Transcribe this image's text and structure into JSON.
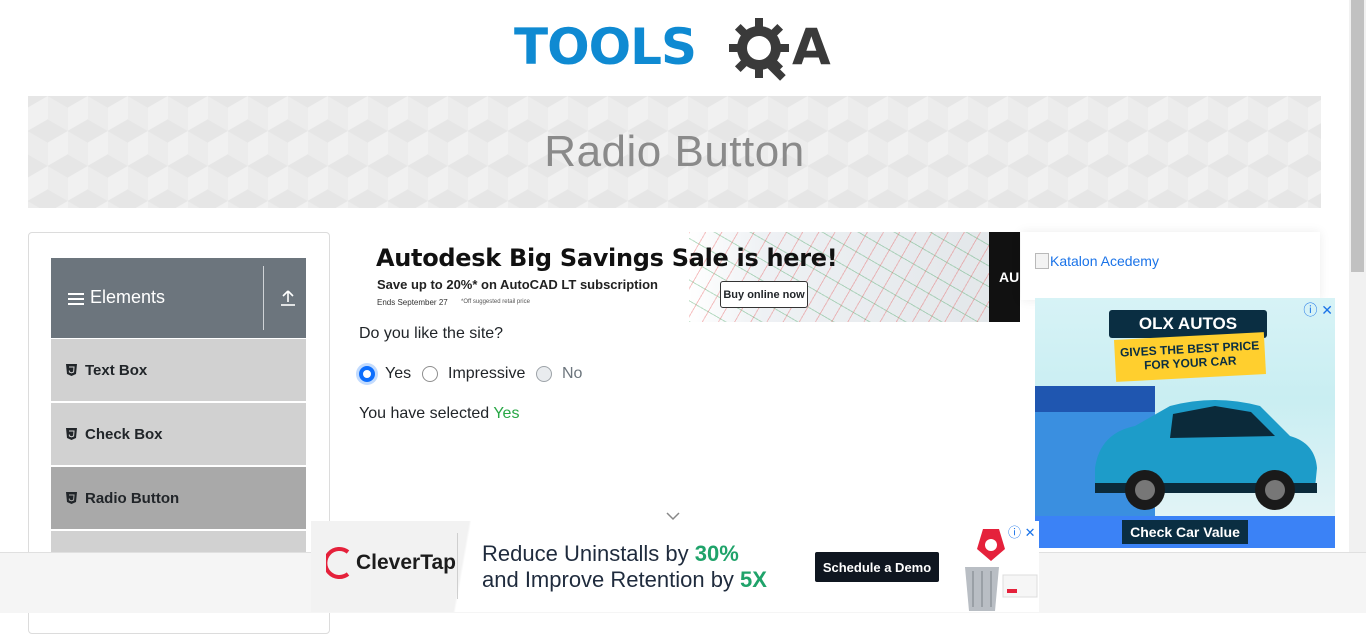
{
  "logo": {
    "text": "TOOLSQA",
    "part1": "TOOLS",
    "part2": "A"
  },
  "banner": {
    "title": "Radio Button"
  },
  "sidebar": {
    "group_title": "Elements",
    "items": [
      {
        "label": "Text Box",
        "active": false
      },
      {
        "label": "Check Box",
        "active": false
      },
      {
        "label": "Radio Button",
        "active": true
      }
    ]
  },
  "top_ad": {
    "title": "Autodesk Big Savings Sale is here!",
    "subtitle": "Save up to 20%* on AutoCAD LT subscription",
    "ends": "Ends September 27",
    "footnote": "*Off suggested retail price",
    "button": "Buy online now",
    "edge_text": "AU"
  },
  "radio_section": {
    "question": "Do you like the site?",
    "options": [
      {
        "label": "Yes",
        "checked": true,
        "disabled": false
      },
      {
        "label": "Impressive",
        "checked": false,
        "disabled": false
      },
      {
        "label": "No",
        "checked": false,
        "disabled": true
      }
    ],
    "result_prefix": "You have selected ",
    "result_value": "Yes"
  },
  "right_ads": {
    "katalon_alt": "Katalon Acedemy",
    "olx_badge": "OLX AUTOS",
    "olx_tagline": "GIVES THE BEST PRICE FOR YOUR CAR",
    "olx_cta": "Check Car Value"
  },
  "bottom_ad": {
    "brand": "CleverTap",
    "line1_prefix": "Reduce Uninstalls by ",
    "line1_value": "30%",
    "line2_prefix": "and Improve Retention by ",
    "line2_value": "5X",
    "button": "Schedule a Demo"
  },
  "colors": {
    "logo_blue": "#0f8ad2",
    "logo_dark": "#3a3a3a",
    "accent": "#0d6efd",
    "success": "#28a745",
    "sidebar_header": "#6c757d"
  }
}
